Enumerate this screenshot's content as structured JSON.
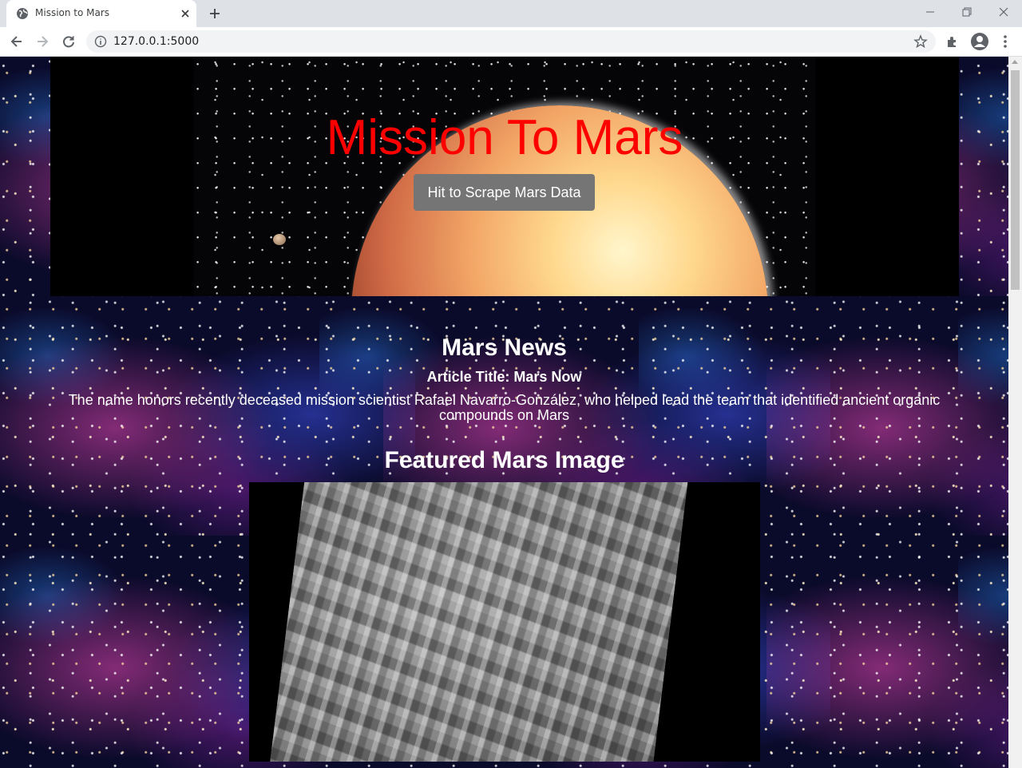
{
  "browser": {
    "tab": {
      "title": "Mission to Mars",
      "favicon": "globe-icon",
      "close": "close-icon"
    },
    "new_tab": "plus-icon",
    "window_controls": [
      "minimize-icon",
      "restore-icon",
      "close-icon"
    ],
    "nav": [
      "back-arrow-icon",
      "forward-arrow-icon",
      "reload-icon"
    ],
    "omnibox": {
      "url": "127.0.0.1:5000",
      "info_icon": "info-icon",
      "bookmark_icon": "star-icon"
    },
    "toolbar_icons": [
      "extensions-icon",
      "profile-icon",
      "menu-icon"
    ]
  },
  "hero": {
    "title": "Mission To Mars",
    "title_color": "#ff0000",
    "scrape_button": "Hit to Scrape Mars Data"
  },
  "news": {
    "heading": "Mars News",
    "article_title_label": "Article Title:",
    "article_title": "Mars Now",
    "article_body": "The name honors recently deceased mission scientist Rafael Navarro-González, who helped lead the team that identified ancient organic compounds on Mars"
  },
  "featured": {
    "heading": "Featured Mars Image"
  }
}
